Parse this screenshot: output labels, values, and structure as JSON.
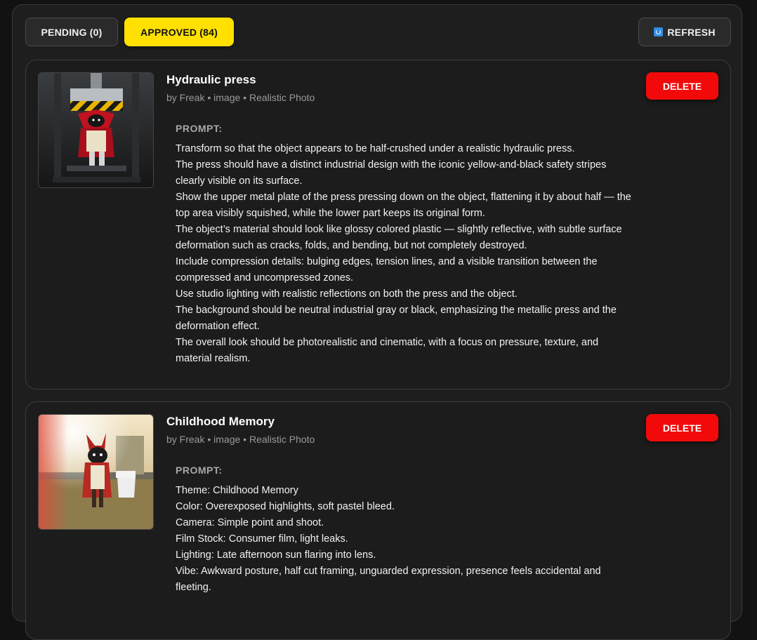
{
  "tabs": {
    "pending_label": "PENDING (0)",
    "approved_label": "APPROVED (84)",
    "refresh_label": "REFRESH"
  },
  "icons": {
    "refresh": "refresh-icon"
  },
  "colors": {
    "approved_accent": "#ffe000",
    "delete": "#f20a0a"
  },
  "cards": [
    {
      "title": "Hydraulic press",
      "meta": "by Freak • image • Realistic Photo",
      "delete_label": "DELETE",
      "prompt_label": "PROMPT:",
      "prompt_lines": [
        "Transform  so that the object  appears to be half-crushed under a realistic hydraulic press.",
        "The press should have a distinct industrial design with the iconic yellow-and-black safety stripes clearly visible on its surface.",
        "Show the upper metal plate of the press pressing down on the object, flattening it by about half — the top area visibly squished, while the lower part keeps its original form.",
        "The object’s material should look like glossy colored plastic — slightly reflective, with subtle surface deformation such as cracks, folds, and bending, but not completely destroyed.",
        "Include compression details: bulging edges, tension lines, and a visible transition between the compressed and uncompressed zones.",
        "Use studio lighting with realistic reflections on both the press and the object.",
        "The background should be neutral industrial gray or black, emphasizing the metallic press and the deformation effect.",
        "The overall look should be photorealistic and cinematic, with a focus on pressure, texture, and material realism."
      ]
    },
    {
      "title": "Childhood Memory",
      "meta": "by Freak • image • Realistic Photo",
      "delete_label": "DELETE",
      "prompt_label": "PROMPT:",
      "prompt_lines": [
        "Theme: Childhood Memory",
        "Color: Overexposed highlights, soft pastel bleed.",
        "Camera: Simple point and shoot.",
        "Film Stock: Consumer film, light leaks.",
        "Lighting: Late afternoon sun flaring into lens.",
        "Vibe: Awkward posture, half cut framing, unguarded expression, presence feels accidental and fleeting."
      ]
    }
  ]
}
